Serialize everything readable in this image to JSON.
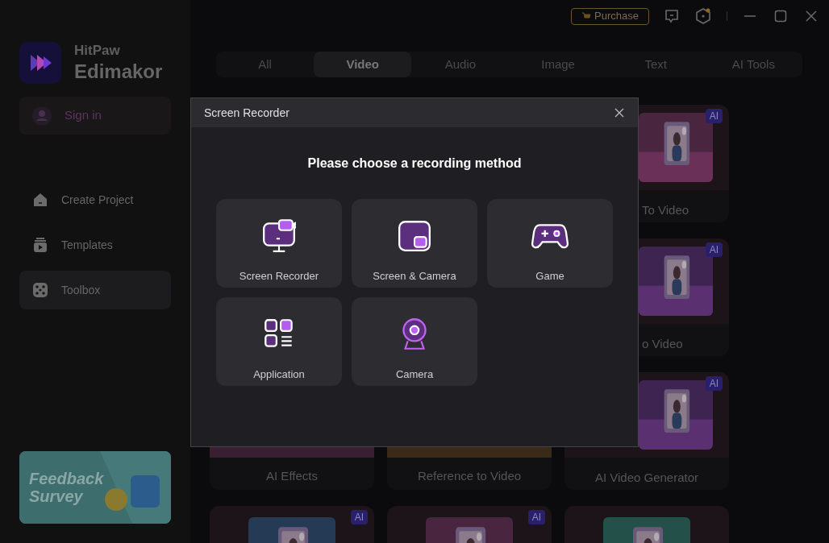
{
  "brand": {
    "line1": "HitPaw",
    "line2": "Edimakor"
  },
  "sign_in": "Sign in",
  "nav": [
    {
      "label": "Create Project",
      "kind": "project",
      "selected": false
    },
    {
      "label": "Templates",
      "kind": "templates",
      "selected": false
    },
    {
      "label": "Toolbox",
      "kind": "toolbox",
      "selected": true
    }
  ],
  "banner": {
    "text": "Feedback Survey"
  },
  "purchase": "Purchase",
  "tabs": [
    {
      "label": "All",
      "selected": false
    },
    {
      "label": "Video",
      "selected": true
    },
    {
      "label": "Audio",
      "selected": false
    },
    {
      "label": "Image",
      "selected": false
    },
    {
      "label": "Text",
      "selected": false
    },
    {
      "label": "AI Tools",
      "selected": false
    }
  ],
  "card_rows": [
    [
      {
        "kind": "picture_right",
        "badge": "AI",
        "label": "To Video"
      }
    ],
    [
      {
        "kind": "picture_right",
        "badge": "AI",
        "label": "o Video"
      }
    ],
    [
      {
        "kind": "covered",
        "label": "AI Effects"
      },
      {
        "kind": "covered",
        "label": "Reference to Video"
      },
      {
        "kind": "picture_right",
        "badge": "AI",
        "label": "AI Video Generator"
      }
    ],
    [
      {
        "kind": "picture",
        "badge": "AI"
      },
      {
        "kind": "picture",
        "badge": "AI"
      },
      {
        "kind": "picture"
      }
    ]
  ],
  "dialog": {
    "title": "Screen Recorder",
    "heading": "Please choose a recording method",
    "options": [
      {
        "label": "Screen Recorder",
        "kind": "screen"
      },
      {
        "label": "Screen & Camera",
        "kind": "screen_camera"
      },
      {
        "label": "Game",
        "kind": "game"
      },
      {
        "label": "Application",
        "kind": "application"
      },
      {
        "label": "Camera",
        "kind": "camera"
      }
    ]
  }
}
